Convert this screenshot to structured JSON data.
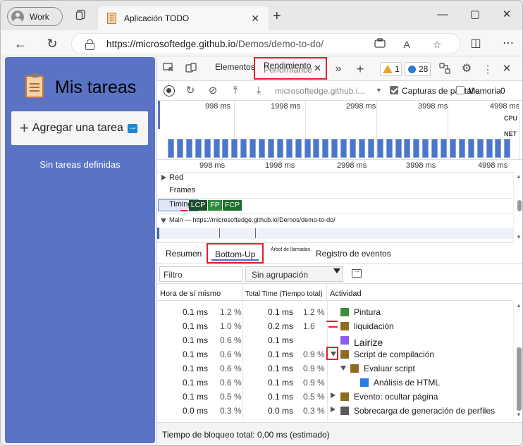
{
  "browser": {
    "profile_label": "Work",
    "tab_title": "Aplicación TODO",
    "url_host": "https://microsoftedge.github.io",
    "url_path": "/Demos/demo-to-do/"
  },
  "page": {
    "app_title": "Mis tareas",
    "add_task_label": "Agregar una tarea",
    "empty_message": "Sin tareas definidas"
  },
  "devtools": {
    "tabs": {
      "elements_label": "Elementos",
      "performance_label": "Rendimiento",
      "performance_ghost": "Performance"
    },
    "warnings_count": "1",
    "messages_count": "28",
    "toolbar": {
      "recording_url": "microsoftedge.github.i...",
      "screenshots_label": "Capturas de pantalla",
      "memory_label": "Memoria",
      "memory_trailing": "0"
    },
    "overview": {
      "ticks": [
        "998 ms",
        "1998 ms",
        "2998 ms",
        "3998 ms",
        "4998 ms"
      ],
      "cpu_label": "CPU",
      "net_label": "NET"
    },
    "flame": {
      "ticks": [
        "998 ms",
        "1998 ms",
        "2998 ms",
        "3998 ms",
        "4998 ms"
      ],
      "tracks": [
        "Red",
        "Frames",
        "Timings"
      ],
      "timing_chips": [
        "LCP",
        "FP",
        "FCP"
      ],
      "main_label": "Main — https://microsoftedge.github.io/Demos/demo-to-do/"
    },
    "bottom_tabs": {
      "summary": "Resumen",
      "bottom_up": "Bottom-Up",
      "call_tree": "Árbol de llamadas",
      "event_log": "Registro de eventos"
    },
    "filter_placeholder": "Filtro",
    "grouping_value": "Sin agrupación",
    "columns": {
      "self_time": "Hora de sí mismo",
      "total_time": "Total Time (Tiempo total)",
      "activity": "Actividad"
    },
    "rows": [
      {
        "self": "0.1 ms",
        "self_pct": "1.2 %",
        "total": "0.1 ms",
        "total_pct": "1.2 %",
        "activity": "Pintura",
        "color": "#3d8b3d"
      },
      {
        "self": "0.1 ms",
        "self_pct": "1.0 %",
        "total": "0.2 ms",
        "total_pct": "1.6",
        "activity": "liquidación",
        "color": "#8c6d1f"
      },
      {
        "self": "0.1 ms",
        "self_pct": "0.6 %",
        "total": "0.1 ms",
        "total_pct": "",
        "activity": "Lairize",
        "color": "#8a5cf0"
      },
      {
        "self": "0.1 ms",
        "self_pct": "0.6 %",
        "total": "0.1 ms",
        "total_pct": "0.9 %",
        "activity": "Script de compilación",
        "color": "#8c6d1f"
      },
      {
        "self": "0.1 ms",
        "self_pct": "0.6 %",
        "total": "0.1 ms",
        "total_pct": "0.9 %",
        "activity": "Evaluar script",
        "color": "#8c6d1f"
      },
      {
        "self": "0.1 ms",
        "self_pct": "0.6 %",
        "total": "0.1 ms",
        "total_pct": "0.9 %",
        "activity": "Análisis de HTML",
        "color": "#2b7de0"
      },
      {
        "self": "0.1 ms",
        "self_pct": "0.5 %",
        "total": "0.1 ms",
        "total_pct": "0.5 %",
        "activity": "Evento: ocultar página",
        "color": "#8c6d1f"
      },
      {
        "self": "0.0 ms",
        "self_pct": "0.3 %",
        "total": "0.0 ms",
        "total_pct": "0.3 %",
        "activity": "Sobrecarga de generación de perfiles",
        "color": "#5a5a5a"
      }
    ],
    "status": "Tiempo de bloqueo total: 0,00 ms (estimado)"
  }
}
